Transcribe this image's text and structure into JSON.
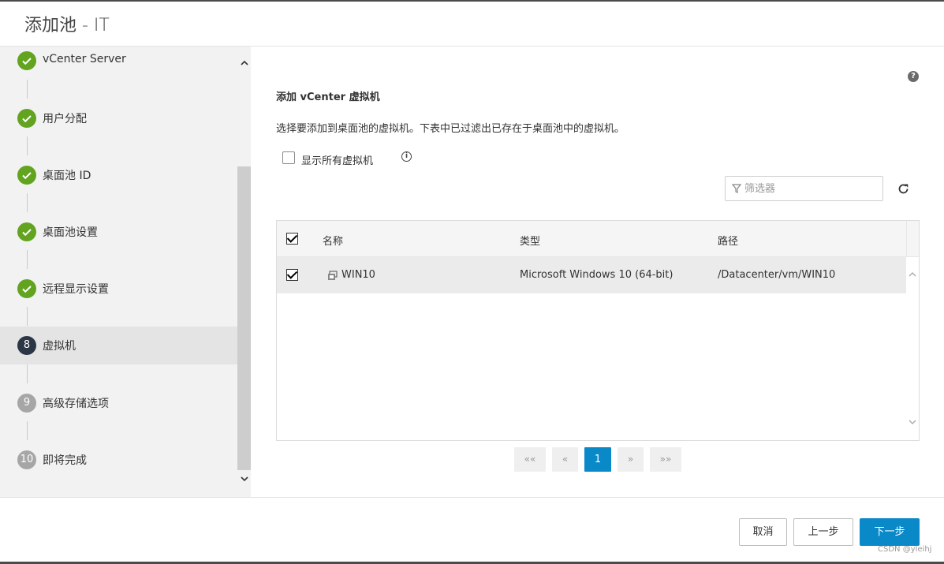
{
  "dialog": {
    "title": "添加池 - IT"
  },
  "sidebar": {
    "steps": [
      {
        "badge": "",
        "label": "vCenter Server",
        "state": "done"
      },
      {
        "badge": "",
        "label": "用户分配",
        "state": "done"
      },
      {
        "badge": "",
        "label": "桌面池 ID",
        "state": "done"
      },
      {
        "badge": "",
        "label": "桌面池设置",
        "state": "done"
      },
      {
        "badge": "",
        "label": "远程显示设置",
        "state": "done"
      },
      {
        "badge": "8",
        "label": "虚拟机",
        "state": "current"
      },
      {
        "badge": "9",
        "label": "高级存储选项",
        "state": "todo"
      },
      {
        "badge": "10",
        "label": "即将完成",
        "state": "todo"
      }
    ]
  },
  "main": {
    "section_title": "添加 vCenter 虚拟机",
    "description": "选择要添加到桌面池的虚拟机。下表中已过滤出已存在于桌面池中的虚拟机。",
    "show_all_label": "显示所有虚拟机",
    "show_all_checked": false,
    "filter_placeholder": "筛选器",
    "table": {
      "columns": [
        "名称",
        "类型",
        "路径"
      ],
      "rows": [
        {
          "checked": true,
          "name": "WIN10",
          "type": "Microsoft Windows 10 (64-bit)",
          "path": "/Datacenter/vm/WIN10"
        }
      ]
    },
    "pagination": {
      "first": "««",
      "prev": "«",
      "current": "1",
      "next": "»",
      "last": "»»"
    }
  },
  "footer": {
    "cancel_label": "取消",
    "back_label": "上一步",
    "next_label": "下一步",
    "watermark": "CSDN @yleihj"
  },
  "colors": {
    "done": "#62a420",
    "current": "#2b3646",
    "todo": "#a6a6a6",
    "primary": "#0a89c9"
  }
}
